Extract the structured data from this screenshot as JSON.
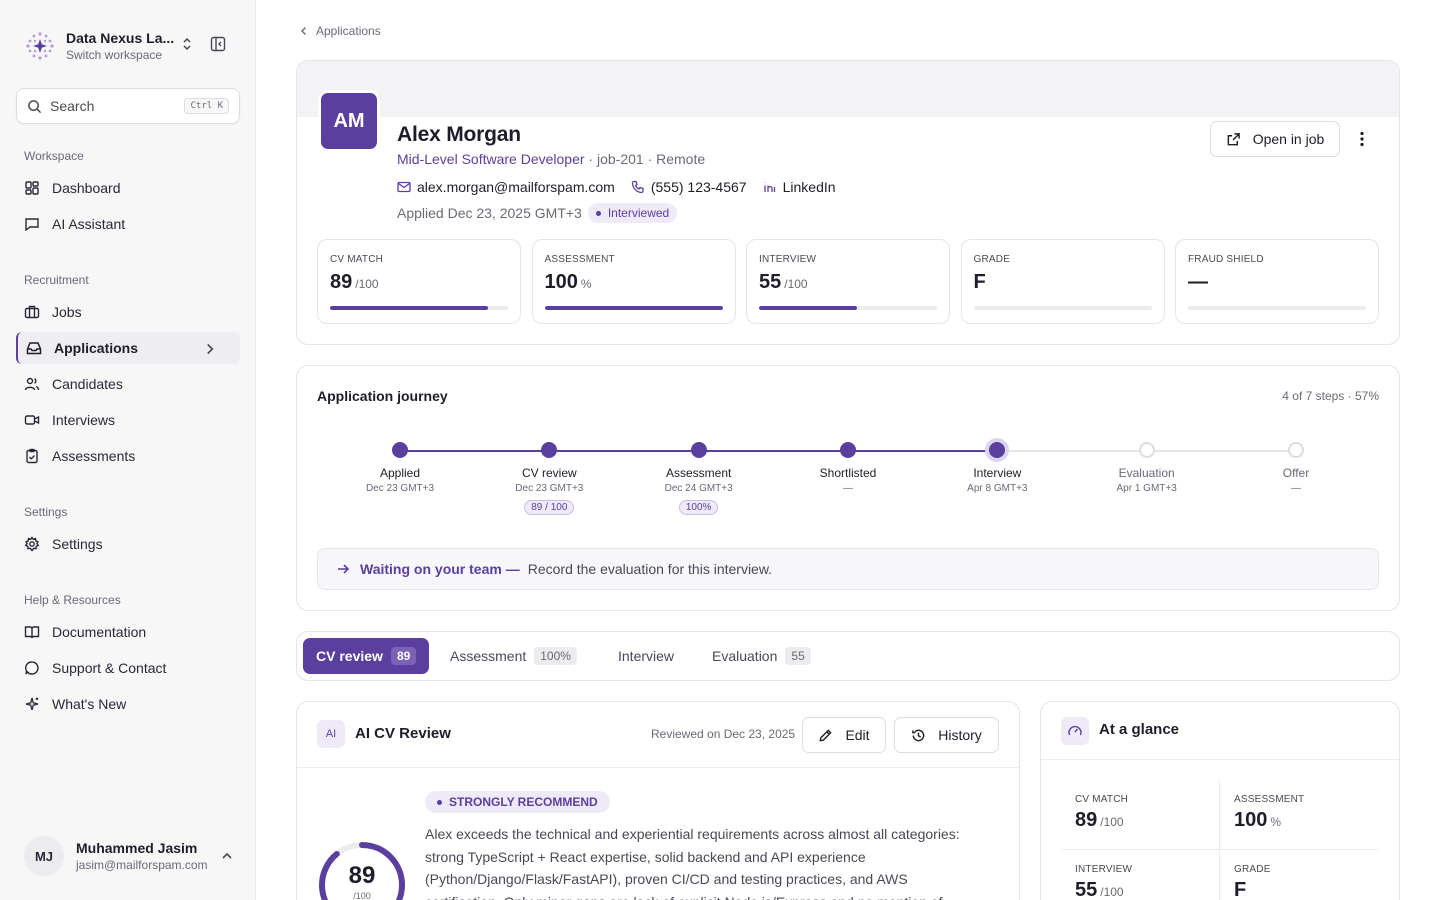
{
  "workspace": {
    "name": "Data Nexus La...",
    "sub": "Switch workspace"
  },
  "search": {
    "placeholder": "Search",
    "shortcut": "Ctrl K"
  },
  "sidebar": {
    "sections": {
      "workspace": "Workspace",
      "recruitment": "Recruitment",
      "settings": "Settings",
      "help": "Help & Resources"
    },
    "items": {
      "dashboard": "Dashboard",
      "ai_assistant": "AI Assistant",
      "jobs": "Jobs",
      "applications": "Applications",
      "candidates": "Candidates",
      "interviews": "Interviews",
      "assessments": "Assessments",
      "settings": "Settings",
      "documentation": "Documentation",
      "support": "Support & Contact",
      "whats_new": "What's New"
    },
    "active": "applications"
  },
  "user": {
    "initials": "MJ",
    "name": "Muhammed Jasim",
    "email": "jasim@mailforspam.com"
  },
  "breadcrumb": {
    "parent": "Applications"
  },
  "candidate": {
    "initials": "AM",
    "name": "Alex Morgan",
    "role": "Mid-Level Software Developer",
    "job_id": "· job-201 · Remote",
    "email": "alex.morgan@mailforspam.com",
    "phone": "(555) 123-4567",
    "linkedin": "LinkedIn",
    "applied": "Applied Dec 23, 2025 GMT+3",
    "status": "Interviewed",
    "open_in_job": "Open in job"
  },
  "metrics": [
    {
      "label": "CV MATCH",
      "value": "89",
      "unit": "/100",
      "progress": 0.89
    },
    {
      "label": "ASSESSMENT",
      "value": "100",
      "unit": "%",
      "progress": 1.0
    },
    {
      "label": "INTERVIEW",
      "value": "55",
      "unit": "/100",
      "progress": 0.55
    },
    {
      "label": "GRADE",
      "value": "F",
      "unit": "",
      "progress": 0
    },
    {
      "label": "FRAUD SHIELD",
      "value": "—",
      "unit": "",
      "progress": 0
    }
  ],
  "journey": {
    "title": "Application journey",
    "summary": "4 of 7 steps · 57%",
    "progress": 0.6667,
    "steps": [
      {
        "name": "Applied",
        "date": "Dec 23 GMT+3",
        "badge": "",
        "state": "done"
      },
      {
        "name": "CV review",
        "date": "Dec 23 GMT+3",
        "badge": "89 / 100",
        "state": "done"
      },
      {
        "name": "Assessment",
        "date": "Dec 24 GMT+3",
        "badge": "100%",
        "state": "done"
      },
      {
        "name": "Shortlisted",
        "date": "—",
        "badge": "",
        "state": "done"
      },
      {
        "name": "Interview",
        "date": "Apr 8 GMT+3",
        "badge": "",
        "state": "current"
      },
      {
        "name": "Evaluation",
        "date": "Apr 1 GMT+3",
        "badge": "",
        "state": "future"
      },
      {
        "name": "Offer",
        "date": "—",
        "badge": "",
        "state": "future"
      }
    ],
    "waiting_title": "Waiting on your team —",
    "waiting_text": "Record the evaluation for this interview."
  },
  "tabs": [
    {
      "label": "CV review",
      "count": "89",
      "active": true
    },
    {
      "label": "Assessment",
      "count": "100%",
      "active": false
    },
    {
      "label": "Interview",
      "count": "",
      "active": false
    },
    {
      "label": "Evaluation",
      "count": "55",
      "active": false
    }
  ],
  "review": {
    "badge": "AI",
    "title": "AI CV Review",
    "date": "Reviewed on Dec 23, 2025",
    "edit": "Edit",
    "history": "History",
    "recommendation": "STRONGLY RECOMMEND",
    "text": "Alex exceeds the technical and experiential requirements across almost all categories: strong TypeScript + React expertise, solid backend and API experience (Python/Django/Flask/FastAPI), proven CI/CD and testing practices, and AWS certification. Only minor gaps are lack of explicit Node.js/Express and no mention of",
    "score": "89",
    "score_sub": "/100",
    "score_progress": 0.89
  },
  "glance": {
    "title": "At a glance",
    "cells": [
      {
        "label": "CV MATCH",
        "value": "89",
        "unit": "/100"
      },
      {
        "label": "ASSESSMENT",
        "value": "100",
        "unit": "%"
      },
      {
        "label": "INTERVIEW",
        "value": "55",
        "unit": "/100"
      },
      {
        "label": "GRADE",
        "value": "F",
        "unit": ""
      }
    ]
  },
  "colors": {
    "accent": "#5b3f9e",
    "accent_light": "#efeaf8"
  }
}
